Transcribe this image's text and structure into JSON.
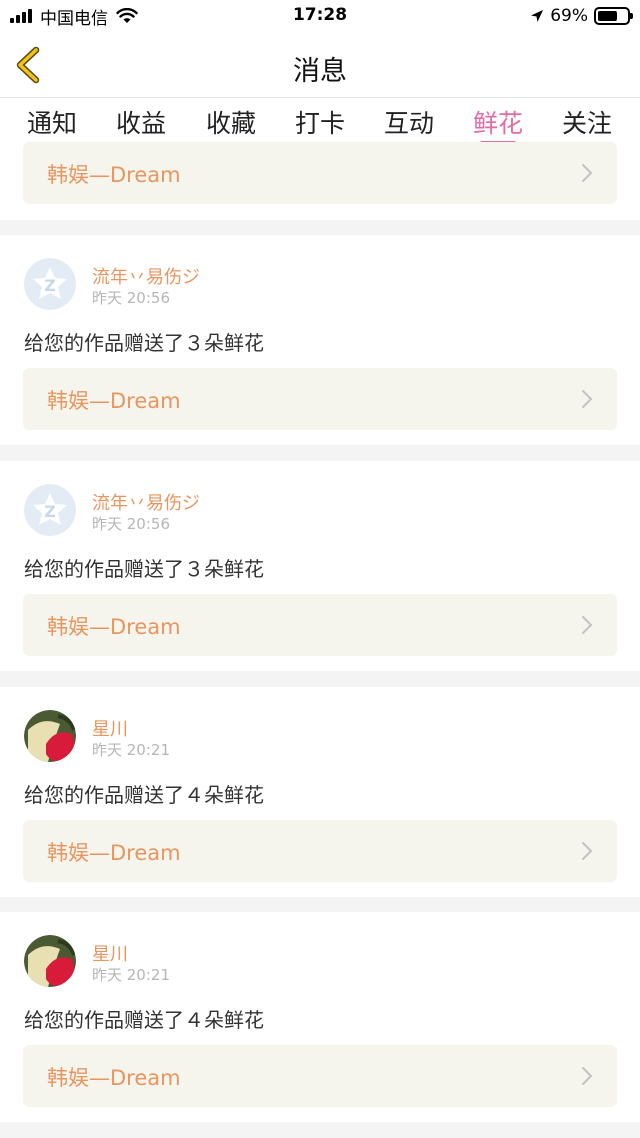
{
  "status_bar": {
    "carrier": "中国电信",
    "time": "17:28",
    "battery": "69%",
    "battery_level": 0.69,
    "icons": [
      "signal-icon",
      "wifi-icon",
      "location-arrow-icon",
      "battery-icon"
    ]
  },
  "nav": {
    "title": "消息",
    "back_icon": "back-chevron-icon",
    "accent_color": "#f0c419"
  },
  "tabs": [
    {
      "label": "通知"
    },
    {
      "label": "收益"
    },
    {
      "label": "收藏"
    },
    {
      "label": "打卡"
    },
    {
      "label": "互动"
    },
    {
      "label": "鲜花",
      "active": true
    },
    {
      "label": "关注"
    }
  ],
  "colors": {
    "active_tab": "#e66aa6",
    "username": "#e8955e",
    "work_title": "#e8955e",
    "timestamp": "#b6b6b6",
    "work_box_bg": "#f5f5ee"
  },
  "partial_card": {
    "work_title": "韩娱—Dream"
  },
  "messages": [
    {
      "username": "流年丷易伤ジ",
      "time": "昨天 20:56",
      "text": "给您的作品赠送了３朵鲜花",
      "work_title": "韩娱—Dream",
      "avatar": "default-avatar-icon"
    },
    {
      "username": "流年丷易伤ジ",
      "time": "昨天 20:56",
      "text": "给您的作品赠送了３朵鲜花",
      "work_title": "韩娱—Dream",
      "avatar": "default-avatar-icon"
    },
    {
      "username": "星川",
      "time": "昨天 20:21",
      "text": "给您的作品赠送了４朵鲜花",
      "work_title": "韩娱—Dream",
      "avatar": "photo-avatar"
    },
    {
      "username": "星川",
      "time": "昨天 20:21",
      "text": "给您的作品赠送了４朵鲜花",
      "work_title": "韩娱—Dream",
      "avatar": "photo-avatar"
    }
  ]
}
